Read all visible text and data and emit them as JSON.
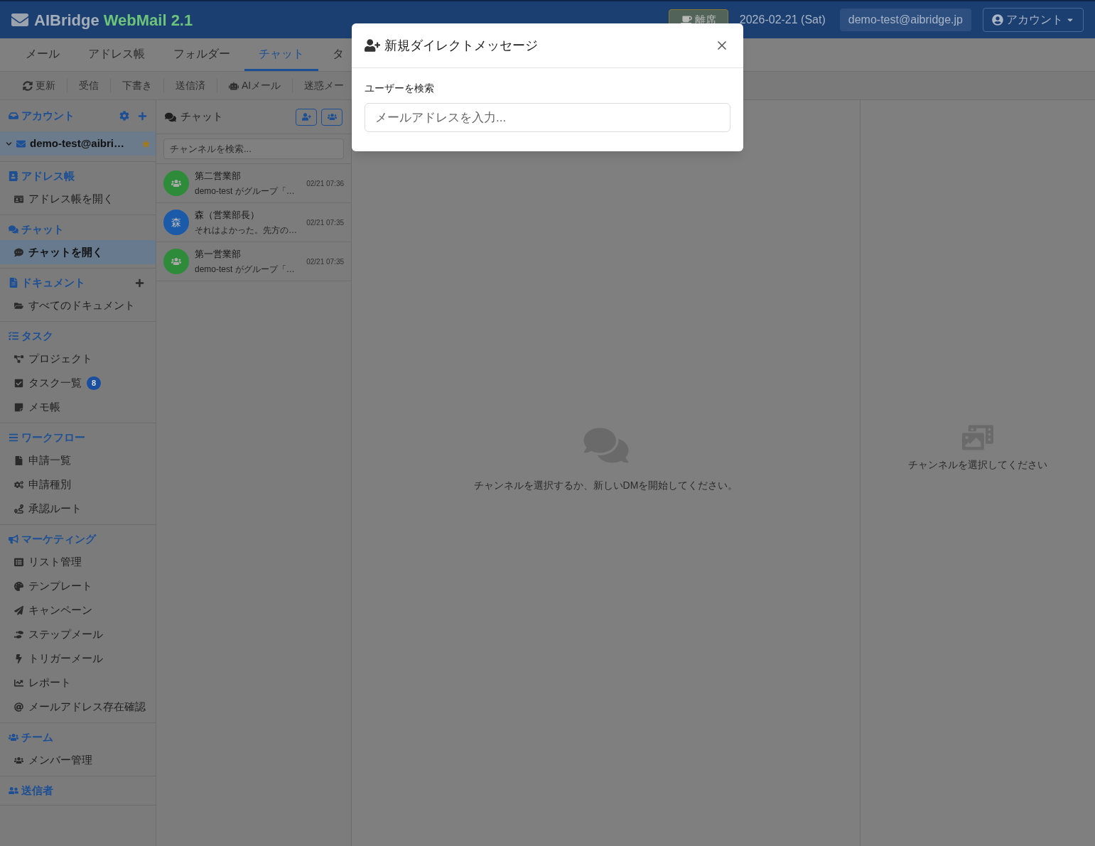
{
  "header": {
    "logo_name": "AIBridge",
    "logo_version": "WebMail 2.1",
    "away_button": "離席",
    "date": "2026-02-21 (Sat)",
    "user_email": "demo-test@aibridge.jp",
    "account_menu": "アカウント"
  },
  "nav_tabs": [
    {
      "label": "メール",
      "selected": false
    },
    {
      "label": "アドレス帳",
      "selected": false
    },
    {
      "label": "フォルダー",
      "selected": false
    },
    {
      "label": "チャット",
      "selected": true
    },
    {
      "label": "タ",
      "selected": false
    }
  ],
  "toolbar": [
    {
      "label": "更新"
    },
    {
      "label": "受信"
    },
    {
      "label": "下書き"
    },
    {
      "label": "送信済"
    },
    {
      "label": "AIメール"
    },
    {
      "label": "迷惑メー"
    }
  ],
  "sidebar": {
    "account_title": "アカウント",
    "account": {
      "label": "demo-test@aibri…",
      "selected": true,
      "starred": true
    },
    "sections": [
      {
        "title": "アドレス帳",
        "items": [
          {
            "label": "アドレス帳を開く",
            "selected": false
          }
        ]
      },
      {
        "title": "チャット",
        "items": [
          {
            "label": "チャットを開く",
            "selected": true
          }
        ]
      },
      {
        "title": "ドキュメント",
        "has_add": true,
        "items": [
          {
            "label": "すべてのドキュメント",
            "selected": false
          }
        ]
      },
      {
        "title": "タスク",
        "items": [
          {
            "label": "プロジェクト",
            "selected": false
          },
          {
            "label": "タスク一覧",
            "selected": false,
            "badge": "8"
          },
          {
            "label": "メモ帳",
            "selected": false
          }
        ]
      },
      {
        "title": "ワークフロー",
        "items": [
          {
            "label": "申請一覧",
            "selected": false
          },
          {
            "label": "申請種別",
            "selected": false
          },
          {
            "label": "承認ルート",
            "selected": false
          }
        ]
      },
      {
        "title": "マーケティング",
        "items": [
          {
            "label": "リスト管理",
            "selected": false
          },
          {
            "label": "テンプレート",
            "selected": false
          },
          {
            "label": "キャンペーン",
            "selected": false
          },
          {
            "label": "ステップメール",
            "selected": false
          },
          {
            "label": "トリガーメール",
            "selected": false
          },
          {
            "label": "レポート",
            "selected": false
          },
          {
            "label": "メールアドレス存在確認",
            "selected": false
          }
        ]
      },
      {
        "title": "チーム",
        "items": [
          {
            "label": "メンバー管理",
            "selected": false
          }
        ]
      },
      {
        "title": "送信者"
      }
    ]
  },
  "chat_list": {
    "title": "チャット",
    "search_placeholder": "チャンネルを検索...",
    "channels": [
      {
        "name": "第二営業部",
        "preview": "demo-test がグループ「…",
        "time": "02/21 07:36",
        "kind": "group",
        "color": "#2e8b3a"
      },
      {
        "name": "森（営業部長）",
        "preview": "それはよかった。先方の…",
        "time": "02/21 07:35",
        "kind": "initial",
        "avatar_text": "森",
        "color": "#1a5aa8"
      },
      {
        "name": "第一営業部",
        "preview": "demo-test がグループ「…",
        "time": "02/21 07:35",
        "kind": "group",
        "color": "#2e8b3a"
      }
    ]
  },
  "main": {
    "empty_message": "チャンネルを選択するか、新しいDMを開始してください。"
  },
  "side_panel": {
    "empty_message": "チャンネルを選択してください"
  },
  "modal": {
    "title": "新規ダイレクトメッセージ",
    "field_label": "ユーザーを検索",
    "field_placeholder": "メールアドレスを入力..."
  }
}
